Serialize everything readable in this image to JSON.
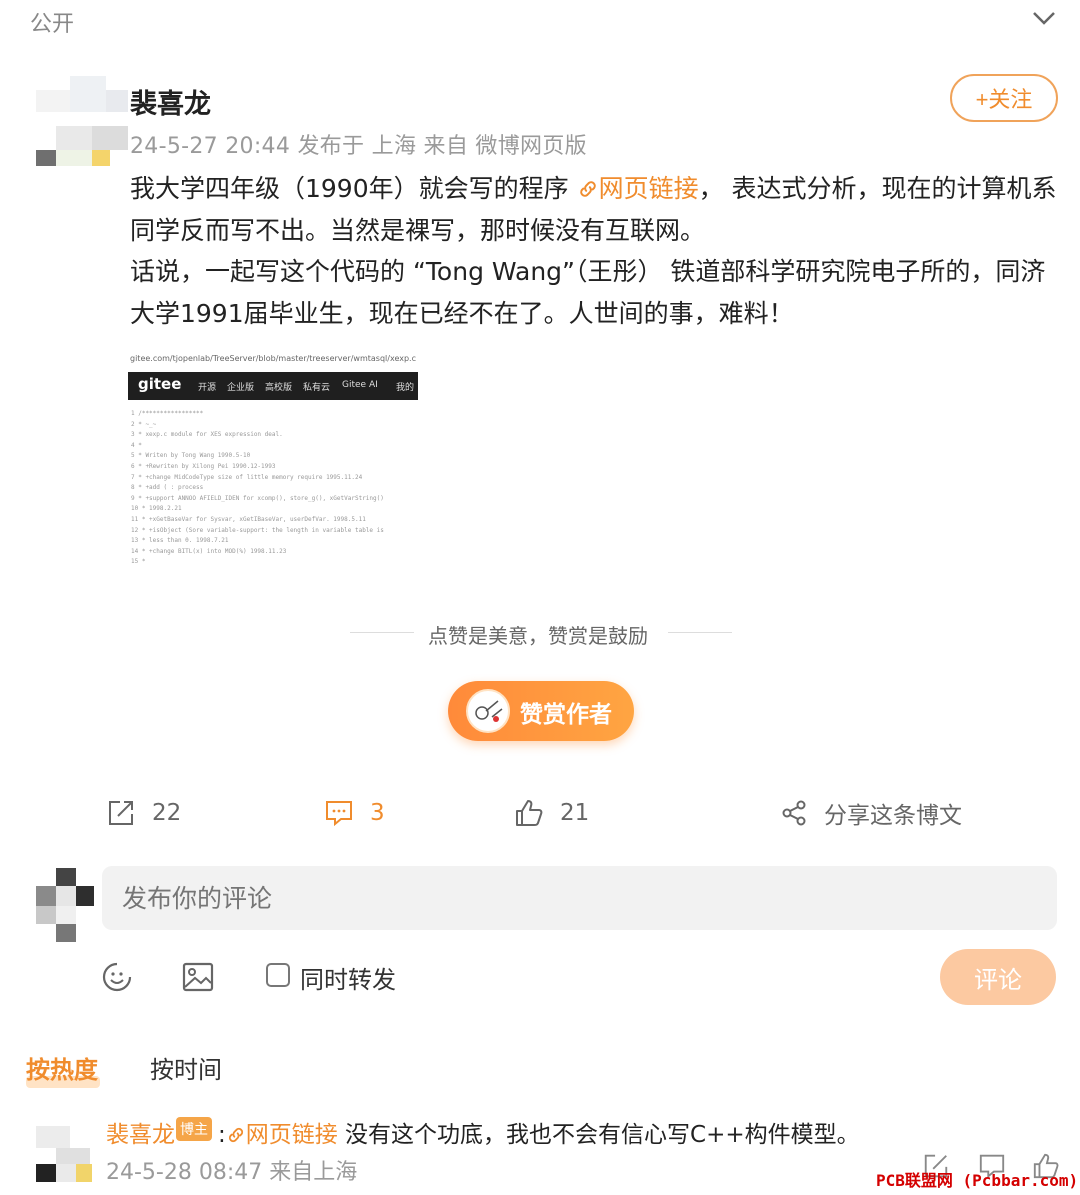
{
  "header": {
    "visibility": "公开"
  },
  "post": {
    "author": "裴喜龙",
    "meta": "24-5-27 20:44 发布于 上海 来自 微博网页版",
    "follow_label": "+关注",
    "p1_before": "我大学四年级（1990年）就会写的程序 ",
    "p1_link": "网页链接",
    "p1_after": "， 表达式分析，现在的计算机系同学反而写不出。当然是裸写，那时候没有互联网。",
    "p2": "话说，一起写这个代码的 “Tong Wang”（王彤） 铁道部科学研究院电子所的，同济大学1991届毕业生，现在已经不在了。人世间的事，难料！"
  },
  "image": {
    "url": "gitee.com/tjopenlab/TreeServer/blob/master/treeserver/wmtasql/xexp.c",
    "logo": "gitee",
    "menu": [
      "开源",
      "企业版",
      "高校版",
      "私有云",
      "Gitee AI",
      "我的"
    ],
    "code": [
      "1   /*****************",
      "2    *  ~_~",
      "3    * xexp.c module for XES expression deal.",
      "4    *",
      "5    * Writen by Tong Wang 1990.5-10",
      "6    *      +Rewriten by Xilong Pei 1990.12-1993",
      "7    *      +change MidCodeType size of little memory require 1995.11.24",
      "8    *      +add ( : process",
      "9    *      +support ANNOO AFIELD_IDEN for xcomp(), store_g(), xGetVarString()",
      "10   *        1998.2.21",
      "11   *      +xGetBaseVar for Sysvar, xGetIBaseVar, userDefVar. 1998.5.11",
      "12   *  +isObject (Sore variable-support: the length in variable table is",
      "13   *    less than 0.   1998.7.21",
      "14   *      +change BITL(x) into MOD(%) 1998.11.23",
      "15   *"
    ]
  },
  "reward": {
    "slogan": "点赞是美意，赞赏是鼓励",
    "button": "赞赏作者"
  },
  "actions": {
    "repost": "22",
    "comment": "3",
    "like": "21",
    "share": "分享这条博文"
  },
  "composer": {
    "placeholder": "发布你的评论",
    "repost_label": "同时转发",
    "submit": "评论"
  },
  "sort": {
    "hot": "按热度",
    "time": "按时间"
  },
  "comment": {
    "author": "裴喜龙",
    "badge": "博主",
    "colon": ":",
    "link": "网页链接",
    "text": " 没有这个功底，我也不会有信心写C++构件模型。",
    "meta": "24-5-28 08:47 来自上海"
  },
  "watermark": "PCB联盟网 (Pcbbar.com)",
  "colors": {
    "accent": "#f08c2d",
    "reward_gradient_start": "#ff8a3a",
    "submit_disabled": "#fcc9a1"
  }
}
